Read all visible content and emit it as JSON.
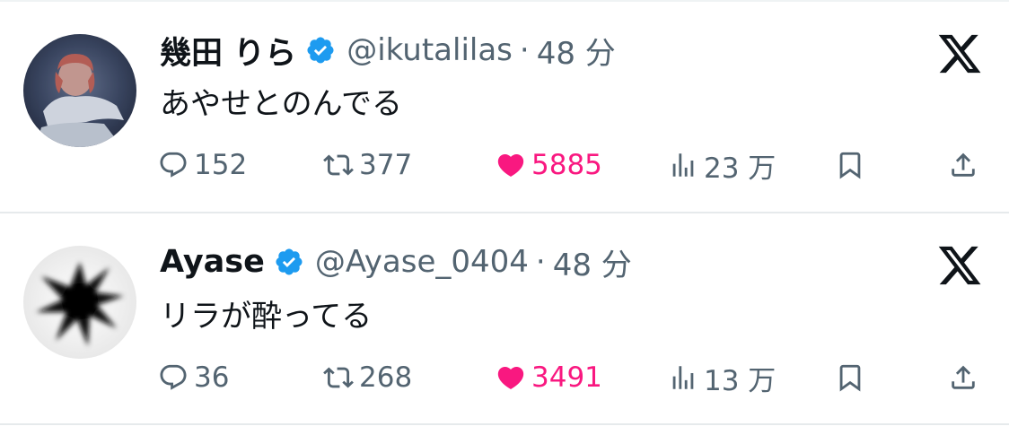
{
  "tweets": [
    {
      "display_name": "幾田 りら",
      "handle": "@ikutalilas",
      "separator": "·",
      "time": "48 分",
      "text": "あやせとのんでる",
      "replies": "152",
      "retweets": "377",
      "likes": "5885",
      "views": "23 万",
      "avatar_icon": "avatar-photo",
      "verified_icon": "verified-badge-icon"
    },
    {
      "display_name": "Ayase",
      "handle": "@Ayase_0404",
      "separator": "·",
      "time": "48 分",
      "text": "リラが酔ってる",
      "replies": "36",
      "retweets": "268",
      "likes": "3491",
      "views": "13 万",
      "avatar_icon": "avatar-ink-blot",
      "verified_icon": "verified-badge-icon"
    }
  ],
  "colors": {
    "text_primary": "#0f1419",
    "text_secondary": "#536471",
    "verified_blue": "#1d9bf0",
    "like_pink": "#f91880",
    "divider": "#e6eaec"
  },
  "icons": [
    "reply-icon",
    "retweet-icon",
    "like-heart-icon",
    "views-icon",
    "bookmark-icon",
    "share-icon",
    "x-logo-icon"
  ]
}
